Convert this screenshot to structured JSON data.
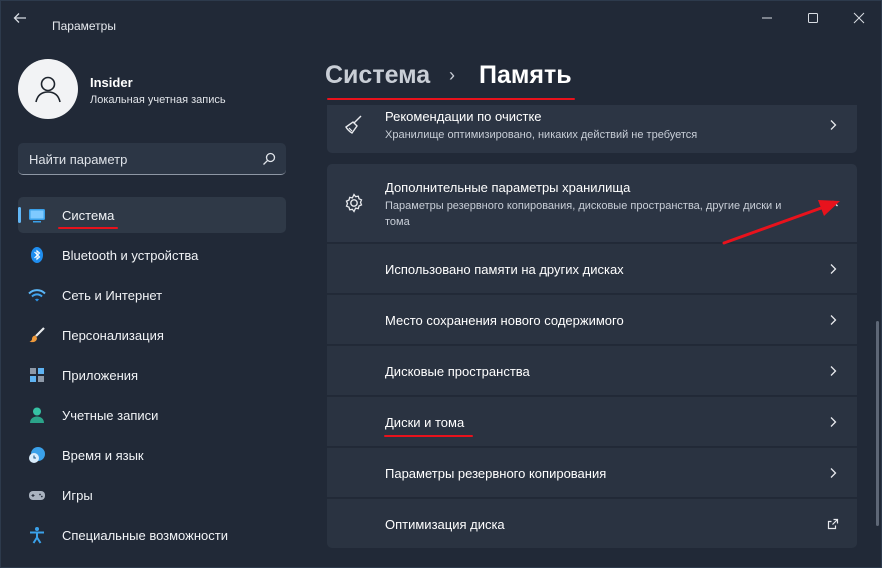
{
  "window": {
    "title": "Параметры"
  },
  "profile": {
    "name": "Insider",
    "account_type": "Локальная учетная запись"
  },
  "search": {
    "placeholder": "Найти параметр"
  },
  "sidebar": {
    "items": [
      {
        "label": "Система",
        "icon": "system-icon",
        "active": true
      },
      {
        "label": "Bluetooth и устройства",
        "icon": "bluetooth-icon"
      },
      {
        "label": "Сеть и Интернет",
        "icon": "wifi-icon"
      },
      {
        "label": "Персонализация",
        "icon": "brush-icon"
      },
      {
        "label": "Приложения",
        "icon": "apps-icon"
      },
      {
        "label": "Учетные записи",
        "icon": "accounts-icon"
      },
      {
        "label": "Время и язык",
        "icon": "time-language-icon"
      },
      {
        "label": "Игры",
        "icon": "gamepad-icon"
      },
      {
        "label": "Специальные возможности",
        "icon": "accessibility-icon"
      }
    ]
  },
  "breadcrumb": {
    "parent": "Система",
    "separator": "›",
    "current": "Память"
  },
  "main": {
    "cleanup": {
      "title": "Рекомендации по очистке",
      "description": "Хранилище оптимизировано, никаких действий не требуется"
    },
    "advanced": {
      "title": "Дополнительные параметры хранилища",
      "description": "Параметры резервного копирования, дисковые пространства, другие диски и тома",
      "expanded": true
    },
    "subitems": [
      {
        "label": "Использовано памяти на других дисках",
        "icon": "chevron-right-icon"
      },
      {
        "label": "Место сохранения нового содержимого",
        "icon": "chevron-right-icon"
      },
      {
        "label": "Дисковые пространства",
        "icon": "chevron-right-icon"
      },
      {
        "label": "Диски и тома",
        "icon": "chevron-right-icon"
      },
      {
        "label": "Параметры резервного копирования",
        "icon": "chevron-right-icon"
      },
      {
        "label": "Оптимизация диска",
        "icon": "external-link-icon"
      }
    ]
  },
  "colors": {
    "accent": "#62b6f5",
    "annotation": "#e8121c",
    "background": "#212937",
    "card": "#2c3544"
  }
}
